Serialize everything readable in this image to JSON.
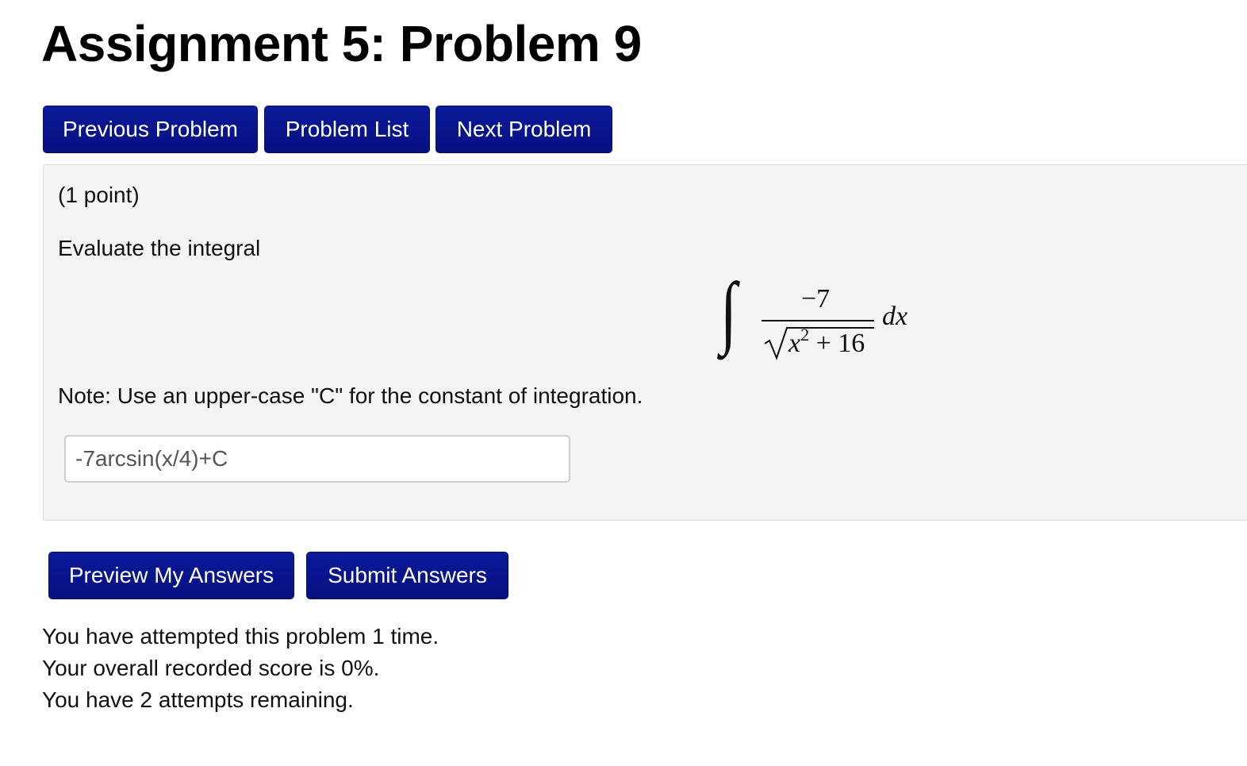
{
  "page_title": "Assignment 5: Problem 9",
  "nav": {
    "previous_label": "Previous Problem",
    "list_label": "Problem List",
    "next_label": "Next Problem"
  },
  "problem": {
    "points": "(1 point)",
    "prompt": "Evaluate the integral",
    "integral": {
      "sign": "∫",
      "numerator": "−7",
      "denominator_var": "x",
      "denominator_exponent": "2",
      "denominator_rest": " + 16",
      "differential": "dx"
    },
    "note": "Note: Use an upper-case \"C\" for the constant of integration.",
    "answer_value": "-7arcsin(x/4)+C"
  },
  "actions": {
    "preview_label": "Preview My Answers",
    "submit_label": "Submit Answers"
  },
  "status": {
    "attempts": "You have attempted this problem 1 time.",
    "score": "Your overall recorded score is 0%.",
    "remaining": "You have 2 attempts remaining."
  },
  "colors": {
    "button_bg": "#0b1a9a",
    "panel_bg": "#f4f4f4"
  }
}
